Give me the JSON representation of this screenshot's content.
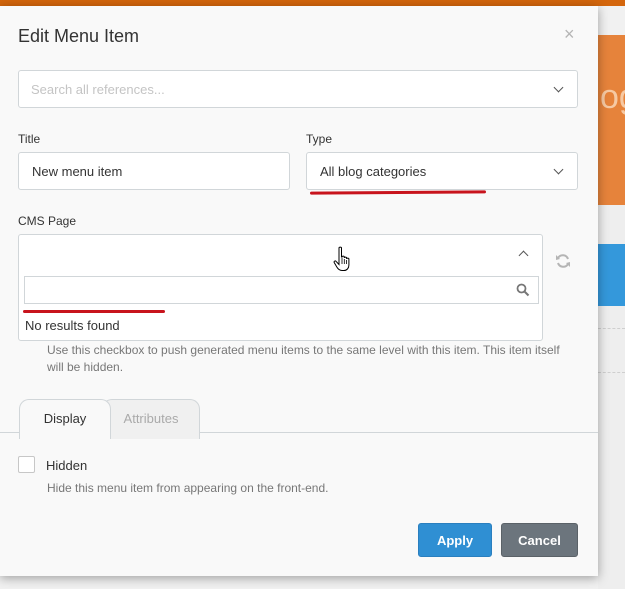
{
  "dialog": {
    "title": "Edit Menu Item",
    "close_glyph": "×"
  },
  "reference_search": {
    "placeholder": "Search all references..."
  },
  "fields": {
    "title_label": "Title",
    "title_value": "New menu item",
    "type_label": "Type",
    "type_value": "All blog categories",
    "cms_page_label": "CMS Page",
    "cms_search_value": "",
    "no_results": "No results found"
  },
  "help": {
    "replace_text": "Use this checkbox to push generated menu items to the same level with this item. This item itself will be hidden."
  },
  "tabs": [
    {
      "label": "Display",
      "active": true
    },
    {
      "label": "Attributes",
      "active": false
    }
  ],
  "hidden": {
    "label": "Hidden",
    "help": "Hide this menu item from appearing on the front-end.",
    "checked": false
  },
  "buttons": {
    "apply": "Apply",
    "cancel": "Cancel"
  },
  "background": {
    "partial_text": "og"
  },
  "colors": {
    "primary": "#2f8fd3",
    "secondary": "#6c757d",
    "annotation_red": "#c8141d",
    "brand_orange": "#d4660c"
  },
  "icons": [
    "close-icon",
    "chevron-down-icon",
    "chevron-up-icon",
    "search-icon",
    "refresh-icon",
    "hand-pointer-icon"
  ]
}
